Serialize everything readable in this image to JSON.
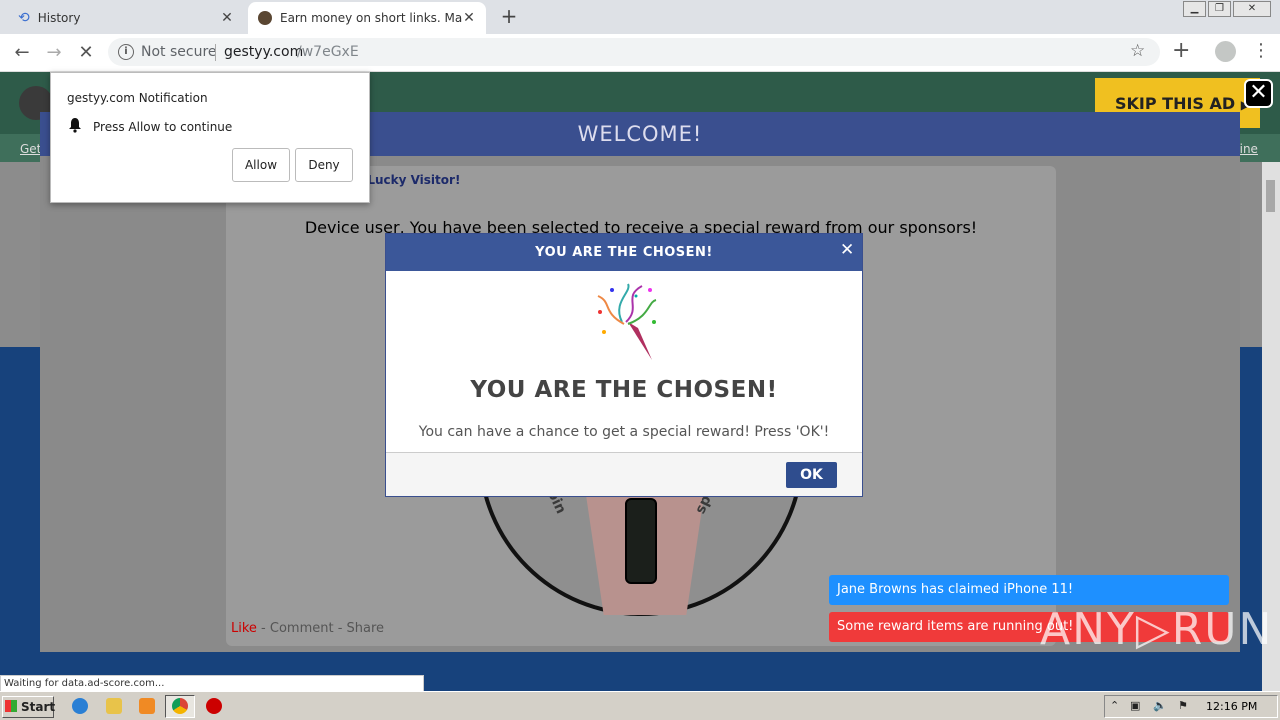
{
  "browser": {
    "tabs": [
      {
        "label": "History"
      },
      {
        "label": "Earn money on short links. Make sho"
      }
    ],
    "new_tab_symbol": "+",
    "close_symbol": "✕",
    "security_label": "Not secure",
    "url_domain": "gestyy.com",
    "url_path": "/w7eGxE",
    "icons": [
      "back-icon",
      "forward-icon",
      "stop-icon",
      "info-icon",
      "star-icon",
      "plus-icon",
      "profile-icon",
      "menu-icon"
    ]
  },
  "page": {
    "skip_ad": "SKIP THIS AD",
    "link_left": "Get",
    "link_right": "nine",
    "welcome": "WELCOME!",
    "lucky_visitor": "e Lucky Visitor!",
    "selected_text": "Device user, You have been selected to receive a special reward from our sponsors!",
    "spin_label": "spin",
    "like": "Like",
    "comment_share": " - Comment - Share",
    "colors": {
      "header": "#3b5799",
      "skip": "#f0c020",
      "page_bg": "#17427c"
    }
  },
  "modal": {
    "header": "YOU ARE THE CHOSEN!",
    "close": "✕",
    "title": "YOU ARE THE CHOSEN!",
    "text": "You can have a chance to get a special reward! Press 'OK'!",
    "ok": "OK"
  },
  "toasts": {
    "claimed": "Jane Browns has claimed iPhone 11!",
    "running_out": "Some reward items are running out!"
  },
  "notification": {
    "title": "gestyy.com Notification",
    "message": "Press Allow to continue",
    "allow": "Allow",
    "deny": "Deny"
  },
  "status_bar": "Waiting for data.ad-score.com...",
  "watermark": "ANY▷RUN",
  "taskbar": {
    "start": "Start",
    "clock": "12:16 PM"
  }
}
